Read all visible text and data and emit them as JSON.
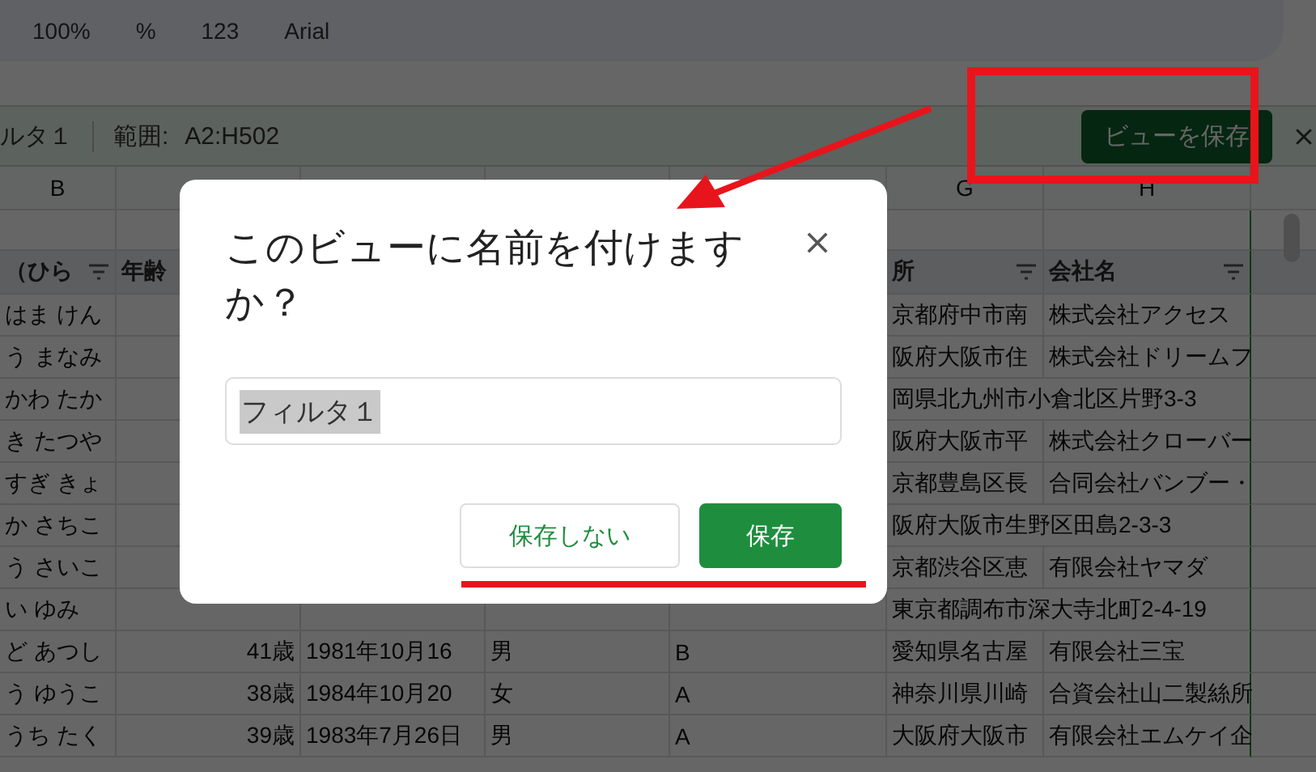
{
  "toolbar": {
    "zoom": "100%",
    "items": [
      "%",
      "123"
    ],
    "font": "Arial"
  },
  "filter_bar": {
    "name": "ルタ１",
    "range_label": "範囲:",
    "range": "A2:H502",
    "save_button": "ビューを保存"
  },
  "column_letters": {
    "b": "B",
    "g": "G",
    "h": "H"
  },
  "header": {
    "b": {
      "text": "（ひら",
      "filter": true
    },
    "c": {
      "text": "年齢"
    },
    "g": {
      "text": "所",
      "filter": true
    },
    "h": {
      "text": "会社名",
      "filter": true
    }
  },
  "rows": [
    {
      "b": "はま けん",
      "g": "京都府中市南",
      "h": "株式会社アクセス"
    },
    {
      "b": "う まなみ",
      "g": "阪府大阪市住",
      "h": "株式会社ドリームフ"
    },
    {
      "b": "かわ たか",
      "g": "岡県北九州市小倉北区片野3-3"
    },
    {
      "b": "き たつや",
      "g": "阪府大阪市平",
      "h": "株式会社クローバー"
    },
    {
      "b": "すぎ きょ",
      "g": "京都豊島区長",
      "h": "合同会社バンブー・"
    },
    {
      "b": "か さちこ",
      "g": "阪府大阪市生野区田島2-3-3"
    },
    {
      "b": "う さいこ",
      "g": "京都渋谷区恵",
      "h": "有限会社ヤマダ"
    },
    {
      "b": "い ゆみ",
      "g": "東京都調布市深大寺北町2-4-19"
    },
    {
      "b": "ど あつし",
      "c": "41歳",
      "d": "1981年10月16",
      "e": "男",
      "f": "B",
      "g": "愛知県名古屋",
      "h": "有限会社三宝"
    },
    {
      "b": "う ゆうこ",
      "c": "38歳",
      "d": "1984年10月20",
      "e": "女",
      "f": "A",
      "g": "神奈川県川崎",
      "h": "合資会社山二製絲所"
    },
    {
      "b": "うち たく",
      "c": "39歳",
      "d": "1983年7月26日",
      "e": "男",
      "f": "A",
      "g": "大阪府大阪市",
      "h": "有限会社エムケイ企"
    }
  ],
  "dialog": {
    "title": "このビューに名前を付けますか？",
    "input": {
      "value": "フィルタ１",
      "selected": true
    },
    "buttons": [
      {
        "label": "保存しない",
        "kind": "secondary"
      },
      {
        "label": "保存",
        "kind": "primary"
      }
    ]
  }
}
